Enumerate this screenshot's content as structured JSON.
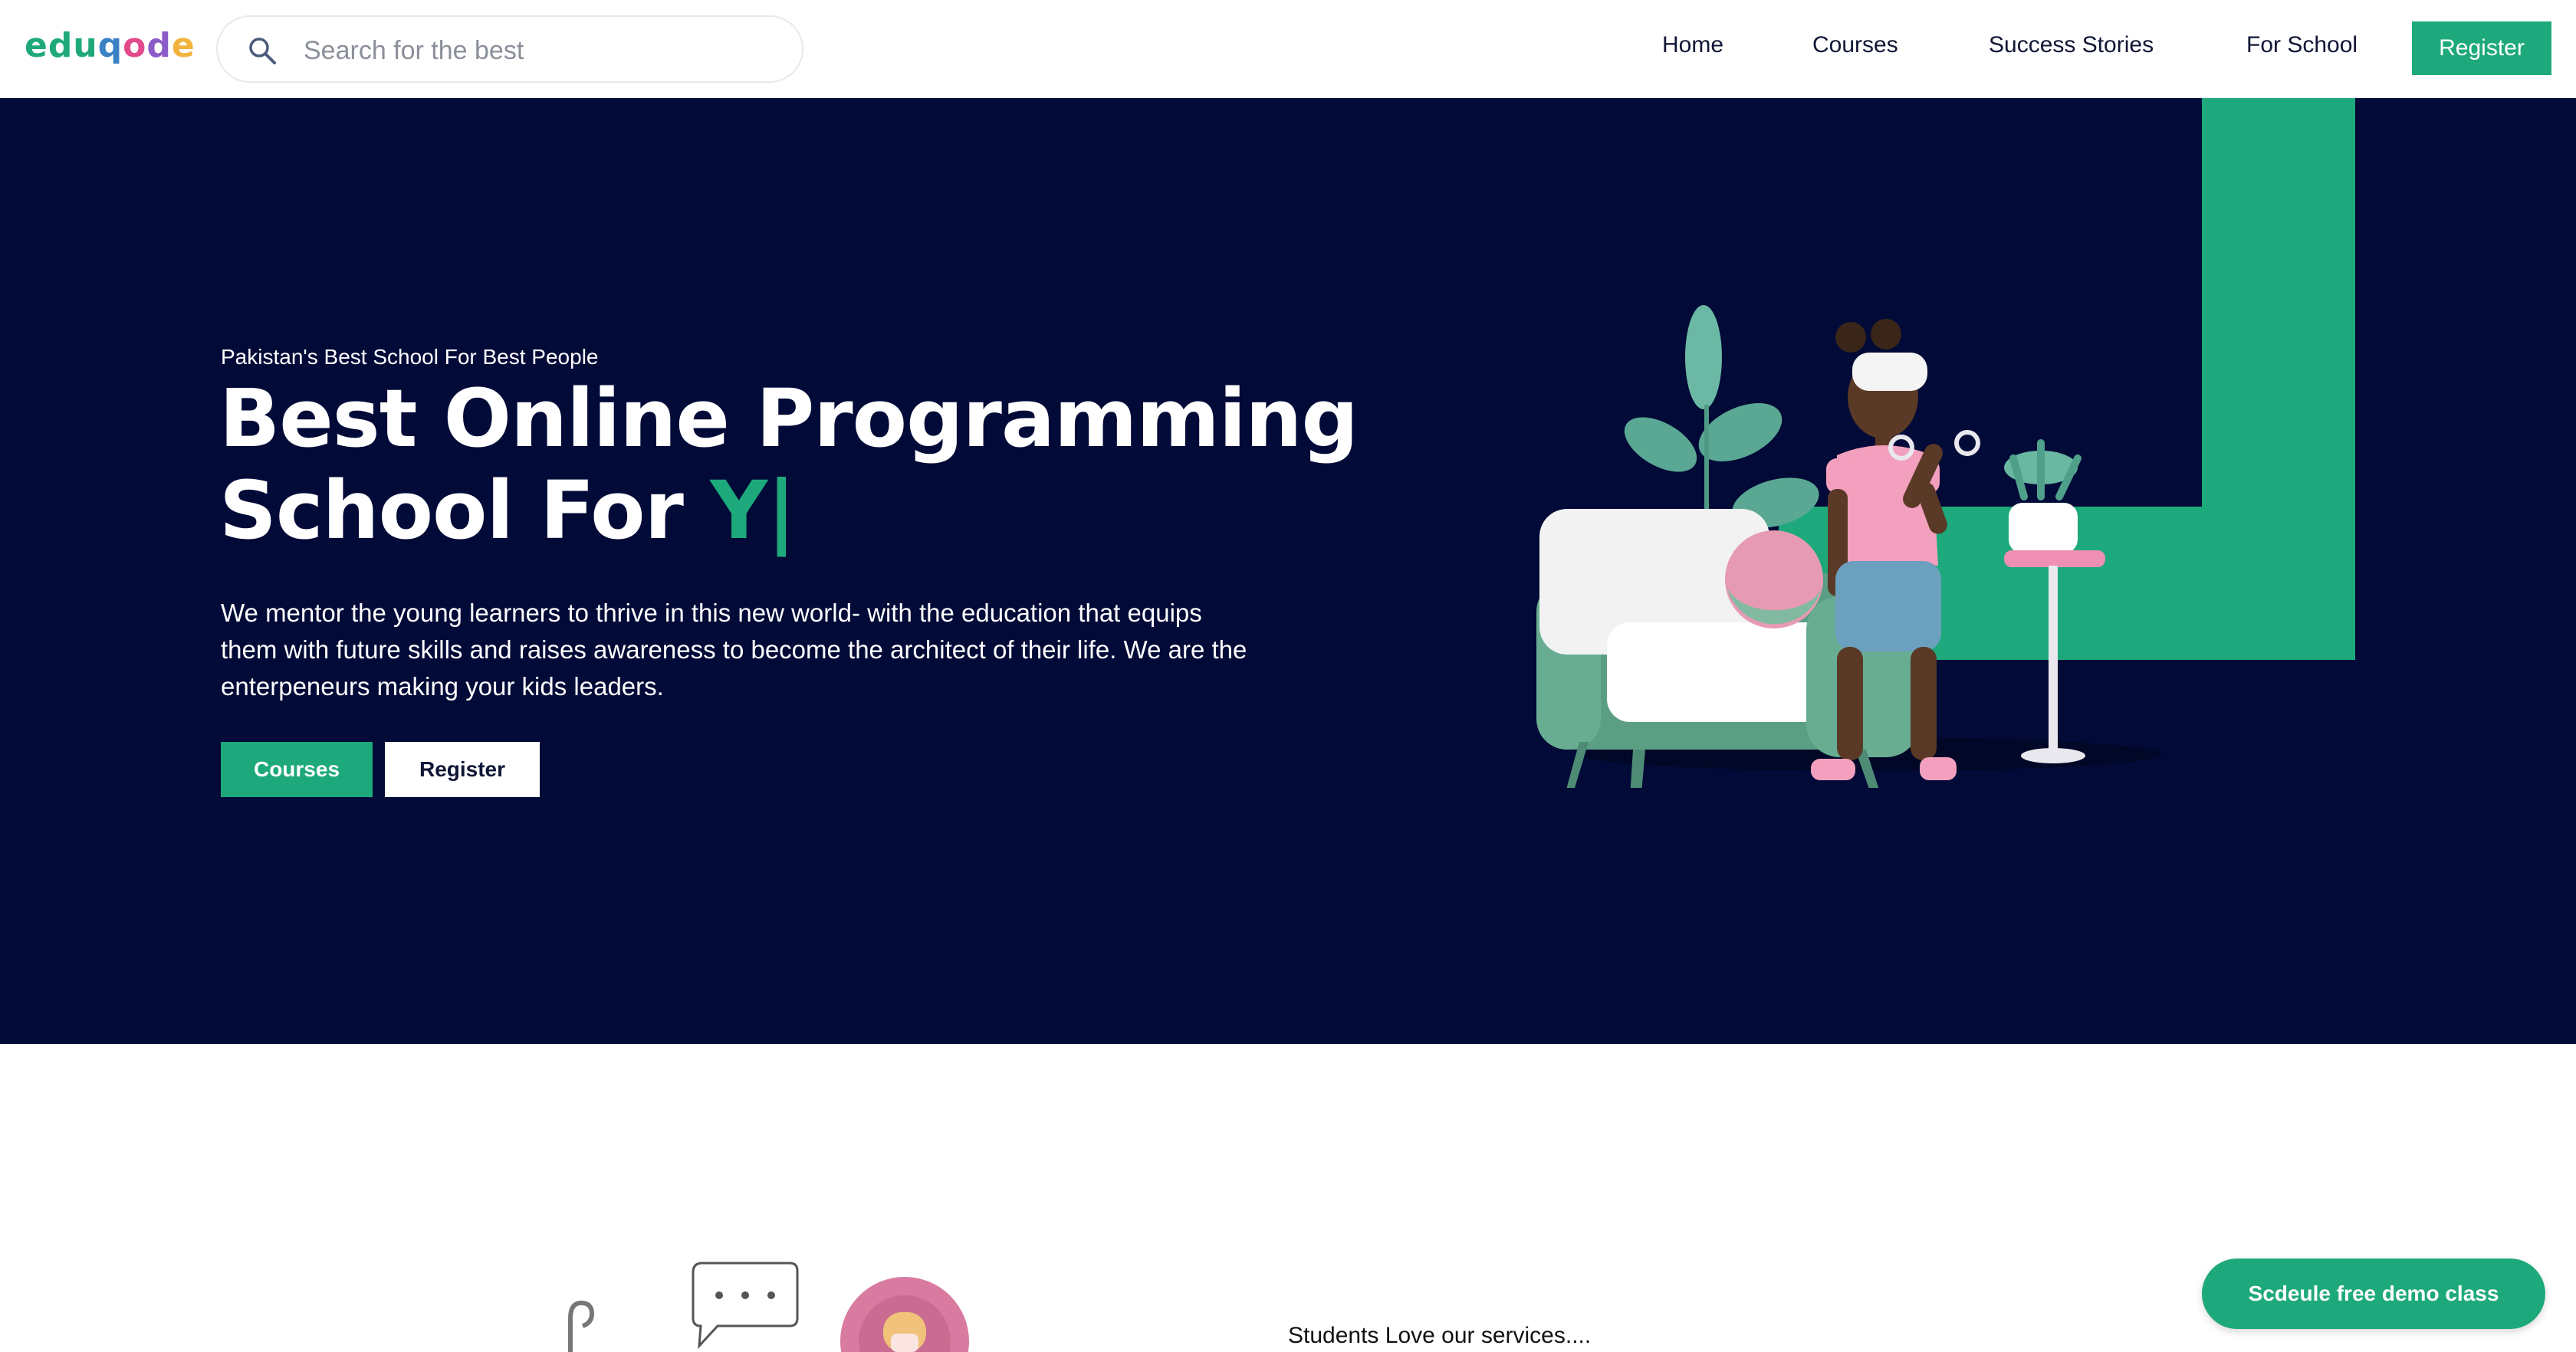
{
  "brand": {
    "logo_letters": [
      {
        "char": "e",
        "color": "#1ea97c"
      },
      {
        "char": "d",
        "color": "#1ea97c"
      },
      {
        "char": "u",
        "color": "#1ea97c"
      },
      {
        "char": "q",
        "color": "#3b82c4"
      },
      {
        "char": "o",
        "color": "#e24b8b"
      },
      {
        "char": "d",
        "color": "#8b5cc7"
      },
      {
        "char": "e",
        "color": "#f2b33d"
      }
    ],
    "accent_color": "#1ea97c",
    "hero_bg": "#020a37"
  },
  "search": {
    "placeholder": "Search for the best",
    "value": "",
    "icon": "search-icon"
  },
  "nav": {
    "links": [
      "Home",
      "Courses",
      "Success Stories",
      "For School"
    ],
    "register_label": "Register"
  },
  "hero": {
    "tagline": "Pakistan's Best School For Best People",
    "title_line1": "Best Online Programming",
    "title_line2_prefix": "School For ",
    "title_typed": "Y|",
    "description": "We mentor the young learners to thrive in this new world- with the education that equips them with future skills and raises awareness to become the architect of their life. We are the enterpeneurs making your kids leaders.",
    "courses_button": "Courses",
    "register_button": "Register"
  },
  "services": {
    "caption": "Students Love our services...."
  },
  "demo": {
    "button_label": "Scdeule free demo class"
  }
}
